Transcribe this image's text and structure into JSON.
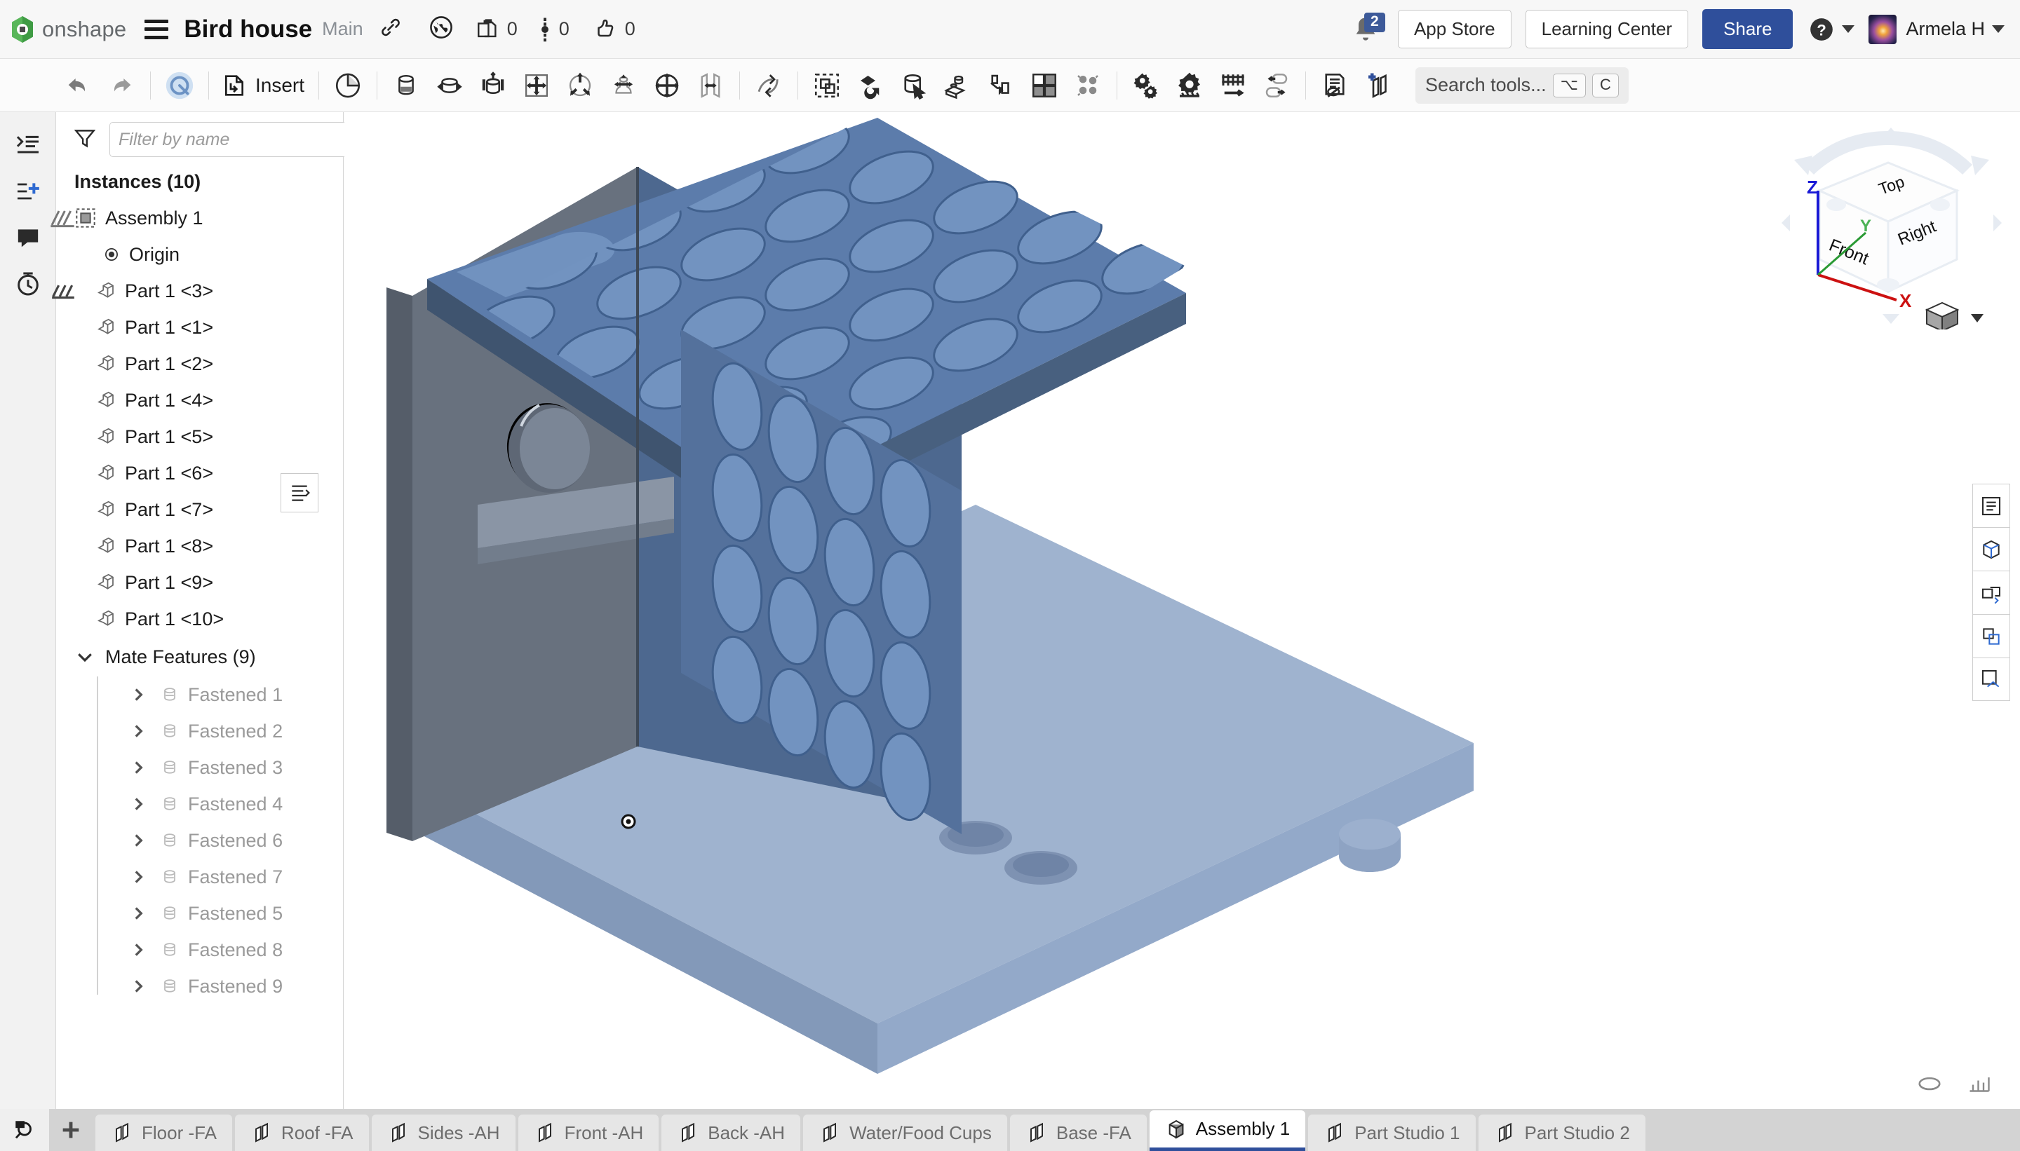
{
  "topbar": {
    "brand": "onshape",
    "document_title": "Bird house",
    "branch": "Main",
    "counters": [
      {
        "icon": "copy-icon",
        "value": "0"
      },
      {
        "icon": "versions-icon",
        "value": "0"
      },
      {
        "icon": "thumbs-up-icon",
        "value": "0"
      }
    ],
    "notification_count": "2",
    "app_store_label": "App Store",
    "learning_center_label": "Learning Center",
    "share_label": "Share",
    "user_name": "Armela H",
    "accent_color": "#2f4f9b"
  },
  "toolbar": {
    "insert_label": "Insert",
    "search_placeholder": "Search tools...",
    "search_kbd_1": "⌥",
    "search_kbd_2": "C"
  },
  "tree": {
    "filter_placeholder": "Filter by name",
    "instances_header": "Instances (10)",
    "assembly_label": "Assembly 1",
    "origin_label": "Origin",
    "parts": [
      "Part 1 <3>",
      "Part 1 <1>",
      "Part 1 <2>",
      "Part 1 <4>",
      "Part 1 <5>",
      "Part 1 <6>",
      "Part 1 <7>",
      "Part 1 <8>",
      "Part 1 <9>",
      "Part 1 <10>"
    ],
    "mate_features_header": "Mate Features (9)",
    "mates": [
      "Fastened 1",
      "Fastened 2",
      "Fastened 3",
      "Fastened 4",
      "Fastened 6",
      "Fastened 7",
      "Fastened 5",
      "Fastened 8",
      "Fastened 9"
    ]
  },
  "viewcube": {
    "top_face": "Top",
    "front_face": "Front",
    "right_face": "Right",
    "axis_z": "Z",
    "axis_y": "Y",
    "axis_x": "X",
    "axis_z_color": "#1a1ad6",
    "axis_y_color": "#2a9a34",
    "axis_x_color": "#cc1111"
  },
  "model": {
    "body_color": "#5b7db1",
    "body_dark": "#46618c",
    "base_color": "#93a9c9",
    "front_face_color": "#66707d"
  },
  "tabs": [
    {
      "label": "Floor -FA",
      "active": false
    },
    {
      "label": "Roof -FA",
      "active": false
    },
    {
      "label": "Sides -AH",
      "active": false
    },
    {
      "label": "Front -AH",
      "active": false
    },
    {
      "label": "Back -AH",
      "active": false
    },
    {
      "label": "Water/Food Cups",
      "active": false
    },
    {
      "label": "Base -FA",
      "active": false
    },
    {
      "label": "Assembly 1",
      "active": true
    },
    {
      "label": "Part Studio 1",
      "active": false
    },
    {
      "label": "Part Studio 2",
      "active": false
    }
  ]
}
